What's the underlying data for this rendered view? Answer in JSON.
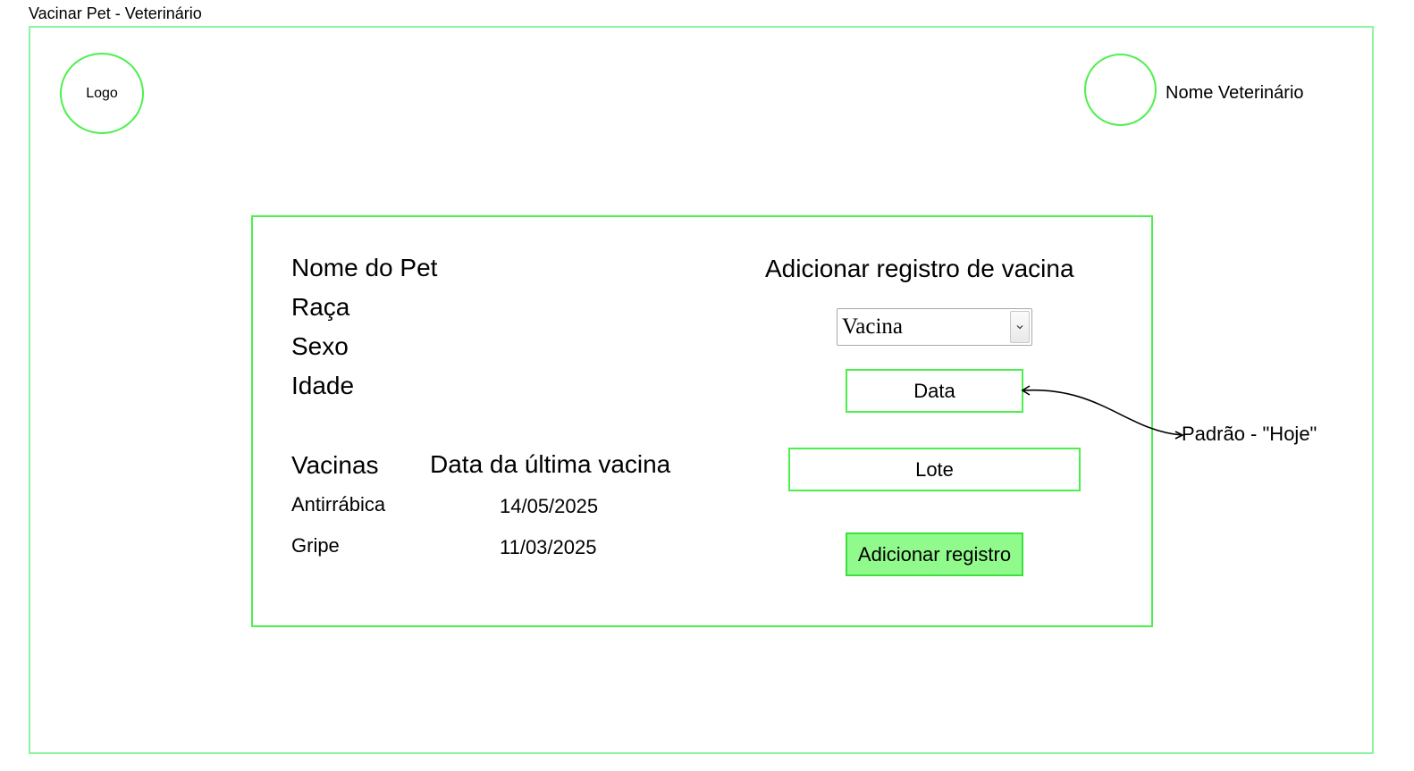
{
  "window": {
    "title": "Vacinar Pet - Veterinário"
  },
  "header": {
    "logo_label": "Logo",
    "vet_name": "Nome Veterinário",
    "avatar_icon": "avatar-circle"
  },
  "pet": {
    "fields": [
      "Nome do Pet",
      "Raça",
      "Sexo",
      "Idade"
    ]
  },
  "vaccines_table": {
    "columns": [
      "Vacinas",
      "Data da última vacina"
    ],
    "rows": [
      [
        "Antirrábica",
        "14/05/2025"
      ],
      [
        "Gripe",
        "11/03/2025"
      ]
    ]
  },
  "form": {
    "title": "Adicionar registro de vacina",
    "vaccine_select": {
      "selected": "Vacina",
      "icon": "chevron-down"
    },
    "date_field": "Data",
    "lote_field": "Lote",
    "submit_label": "Adicionar registro"
  },
  "annotation": {
    "text": "Padrão - \"Hoje\""
  },
  "colors": {
    "frame_border": "#8cf5a0",
    "accent_border": "#4cf04c",
    "button_fill": "#90fa8c"
  }
}
